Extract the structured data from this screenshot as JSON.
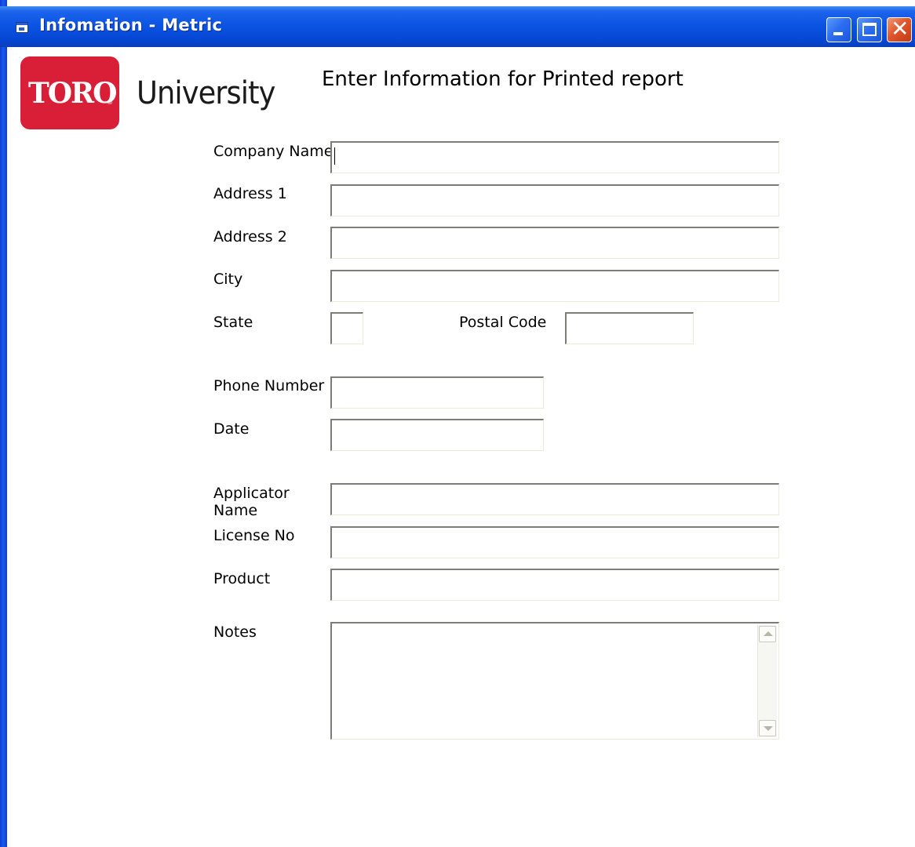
{
  "window": {
    "title": "Infomation - Metric"
  },
  "logo": {
    "brand": "TORO",
    "registered": "®",
    "subtitle": "University"
  },
  "form": {
    "heading": "Enter Information for Printed report",
    "labels": {
      "company_name": "Company Name",
      "address1": "Address 1",
      "address2": "Address 2",
      "city": "City",
      "state": "State",
      "postal_code": "Postal Code",
      "phone_number": "Phone Number",
      "date": "Date",
      "applicator_name_line1": "Applicator",
      "applicator_name_line2": "Name",
      "license_no": "License No",
      "product": "Product",
      "notes": "Notes"
    },
    "values": {
      "company_name": "",
      "address1": "",
      "address2": "",
      "city": "",
      "state": "",
      "postal_code": "",
      "phone_number": "",
      "date": "",
      "applicator_name": "",
      "license_no": "",
      "product": "",
      "notes": ""
    }
  },
  "colors": {
    "titlebar": "#0a53e2",
    "logo_red": "#d91f38"
  },
  "icons": {
    "app": "app-window-icon",
    "minimize": "minimize-icon",
    "maximize": "maximize-icon",
    "close": "close-icon",
    "scroll_up": "scroll-up-arrow-icon",
    "scroll_down": "scroll-down-arrow-icon"
  }
}
